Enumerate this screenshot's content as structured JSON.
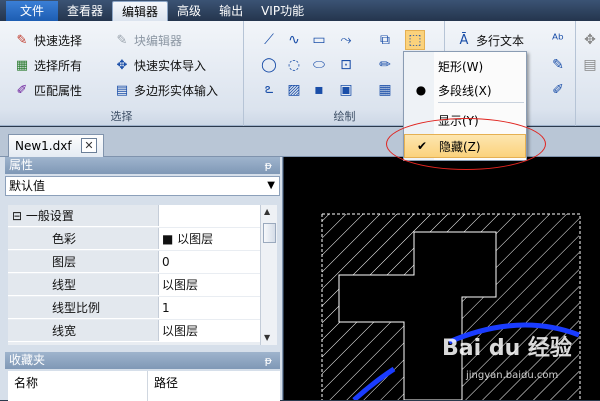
{
  "menu": {
    "items": [
      {
        "label": "文件"
      },
      {
        "label": "查看器"
      },
      {
        "label": "编辑器"
      },
      {
        "label": "高级"
      },
      {
        "label": "输出"
      },
      {
        "label": "VIP功能"
      }
    ]
  },
  "ribbon": {
    "select_group": {
      "title": "选择",
      "buttons": [
        {
          "label": "快速选择"
        },
        {
          "label": "块编辑器"
        },
        {
          "label": "选择所有"
        },
        {
          "label": "快速实体导入"
        },
        {
          "label": "匹配属性"
        },
        {
          "label": "多边形实体输入"
        }
      ]
    },
    "draw_group": {
      "title": "绘制"
    },
    "text_group": {
      "multiline_text": "多行文本"
    }
  },
  "dropdown": {
    "items": [
      {
        "label": "矩形(W)",
        "marker": ""
      },
      {
        "label": "多段线(X)",
        "marker": "●"
      },
      {
        "label": "显示(Y)",
        "marker": ""
      },
      {
        "label": "隐藏(Z)",
        "marker": "✔"
      }
    ]
  },
  "doc_tab": {
    "label": "New1.dxf",
    "close": "✕"
  },
  "properties": {
    "header": "属性",
    "pin": "ᵽ",
    "combo_value": "默认值",
    "category": "⊟ 一般设置",
    "rows": [
      {
        "name": "色彩",
        "value": "■ 以图层"
      },
      {
        "name": "图层",
        "value": "0"
      },
      {
        "name": "线型",
        "value": "以图层"
      },
      {
        "name": "线型比例",
        "value": "1"
      },
      {
        "name": "线宽",
        "value": "以图层"
      }
    ]
  },
  "favorites": {
    "header": "收藏夹",
    "pin": "ᵽ",
    "col_name": "名称",
    "col_path": "路径"
  },
  "watermark": {
    "text": "Bai du 经验",
    "url": "jingyan.baidu.com"
  },
  "colors": {
    "accent": "#1d5db2",
    "highlight": "#fbd27c",
    "annotation": "#e0241f",
    "arc": "#1a3cff"
  }
}
